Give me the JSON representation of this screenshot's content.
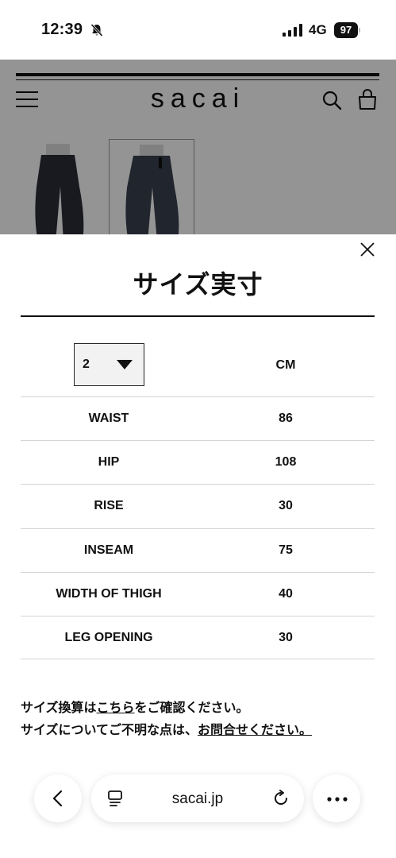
{
  "status_bar": {
    "time": "12:39",
    "network": "4G",
    "battery": "97",
    "icons": [
      "bell-muted-icon",
      "signal-icon",
      "battery-icon"
    ]
  },
  "header": {
    "logo": "sacai",
    "icons": [
      "menu-icon",
      "search-icon",
      "bag-icon"
    ]
  },
  "modal": {
    "title": "サイズ実寸",
    "size_select": {
      "value": "2"
    },
    "unit_header": "CM",
    "rows": [
      {
        "label": "WAIST",
        "value": "86"
      },
      {
        "label": "HIP",
        "value": "108"
      },
      {
        "label": "RISE",
        "value": "30"
      },
      {
        "label": "INSEAM",
        "value": "75"
      },
      {
        "label": "WIDTH OF THIGH",
        "value": "40"
      },
      {
        "label": "LEG OPENING",
        "value": "30"
      }
    ],
    "note1": {
      "before": "サイズ換算は",
      "link": "こちら",
      "after": "をご確認ください。"
    },
    "note2": {
      "before": "サイズについてご不明な点は、",
      "link": "お問合せください。"
    }
  },
  "browser_bar": {
    "url": "sacai.jp",
    "icons": [
      "back-icon",
      "tab-icon",
      "reload-icon",
      "more-icon"
    ]
  },
  "colors": {
    "text": "#111111",
    "overlay": "rgba(0,0,0,0.42)",
    "divider": "#d4d4d4"
  }
}
